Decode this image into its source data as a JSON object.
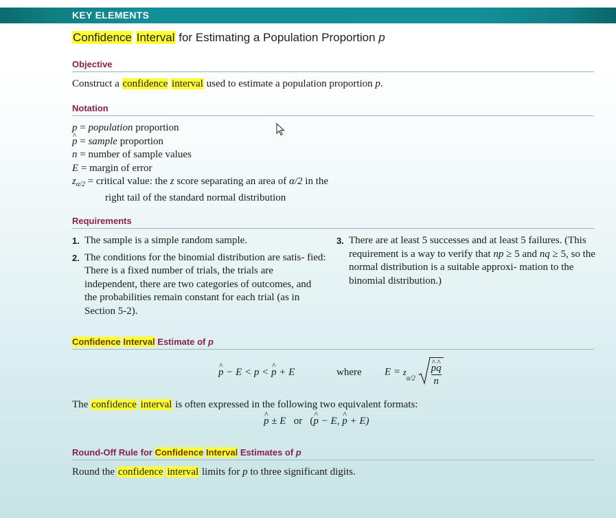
{
  "banner": {
    "label": "KEY ELEMENTS"
  },
  "title": {
    "hl1": "Confidence",
    "hl2": "Interval",
    "rest": " for Estimating a Population Proportion ",
    "var": "p"
  },
  "objective": {
    "heading": "Objective",
    "pre": "Construct a ",
    "hl1": "confidence",
    "hl2": "interval",
    "post": " used to estimate a population proportion ",
    "var": "p",
    "end": "."
  },
  "notation": {
    "heading": "Notation",
    "rows": [
      {
        "sym": "p",
        "eq": " = ",
        "italic": "population",
        "text": " proportion"
      },
      {
        "sym": "p",
        "eq": " = ",
        "italic": "sample",
        "text": " proportion"
      },
      {
        "sym": "n",
        "eq": " = ",
        "text": "number of sample values"
      },
      {
        "sym": "E",
        "eq": " = ",
        "text": "margin of error"
      }
    ],
    "z_sym": "z",
    "z_sub": "α/2",
    "z_eq": " = ",
    "z_text1": "critical value: the ",
    "z_var": "z",
    "z_text2": " score separating an area of ",
    "z_alpha": "α/2",
    "z_text3": " in the",
    "z_line2": "right tail of the standard normal distribution"
  },
  "requirements": {
    "heading": "Requirements",
    "items": [
      {
        "num": "1.",
        "text": "The sample is a simple random sample."
      },
      {
        "num": "2.",
        "text": "The conditions for the binomial distribution are satis- fied: There is a fixed number of trials, the trials are independent, there are two categories of outcomes, and the probabilities remain constant for each trial (as in Section 5-2)."
      },
      {
        "num": "3.",
        "text1": "There are at least 5 successes and at least 5 failures. (This requirement is a way to verify that ",
        "np": "np",
        "ge1": " ≥ 5 and ",
        "nq": "nq",
        "ge2": " ≥ 5, so the normal distribution is a suitable approxi- mation to the binomial distribution.)"
      }
    ]
  },
  "ci_estimate": {
    "heading_hl1": "Confidence",
    "heading_hl2": "Interval",
    "heading_rest": " Estimate of ",
    "heading_var": "p",
    "ineq_left": " − E < p < ",
    "ineq_right": " + E",
    "where": "where",
    "e_lhs": "E = ",
    "e_z": "z",
    "e_sub": "α/2",
    "frac_num": "pq",
    "frac_den": "n",
    "formats_pre": "The ",
    "formats_hl1": "confidence",
    "formats_hl2": "interval",
    "formats_post": " is often expressed in the following two equivalent formats:",
    "fmt1": " ± E",
    "fmt_or": "or",
    "fmt2_open": "(",
    "fmt2_mid": " − E, ",
    "fmt2_end": " + E)"
  },
  "roundoff": {
    "heading_pre": "Round-Off Rule for ",
    "heading_hl1": "Confidence",
    "heading_hl2": "Interval",
    "heading_rest": " Estimates of ",
    "heading_var": "p",
    "pre": "Round the ",
    "hl1": "confidence",
    "hl2": "interval",
    "mid": " limits for ",
    "var": "p",
    "post": " to three significant digits."
  }
}
